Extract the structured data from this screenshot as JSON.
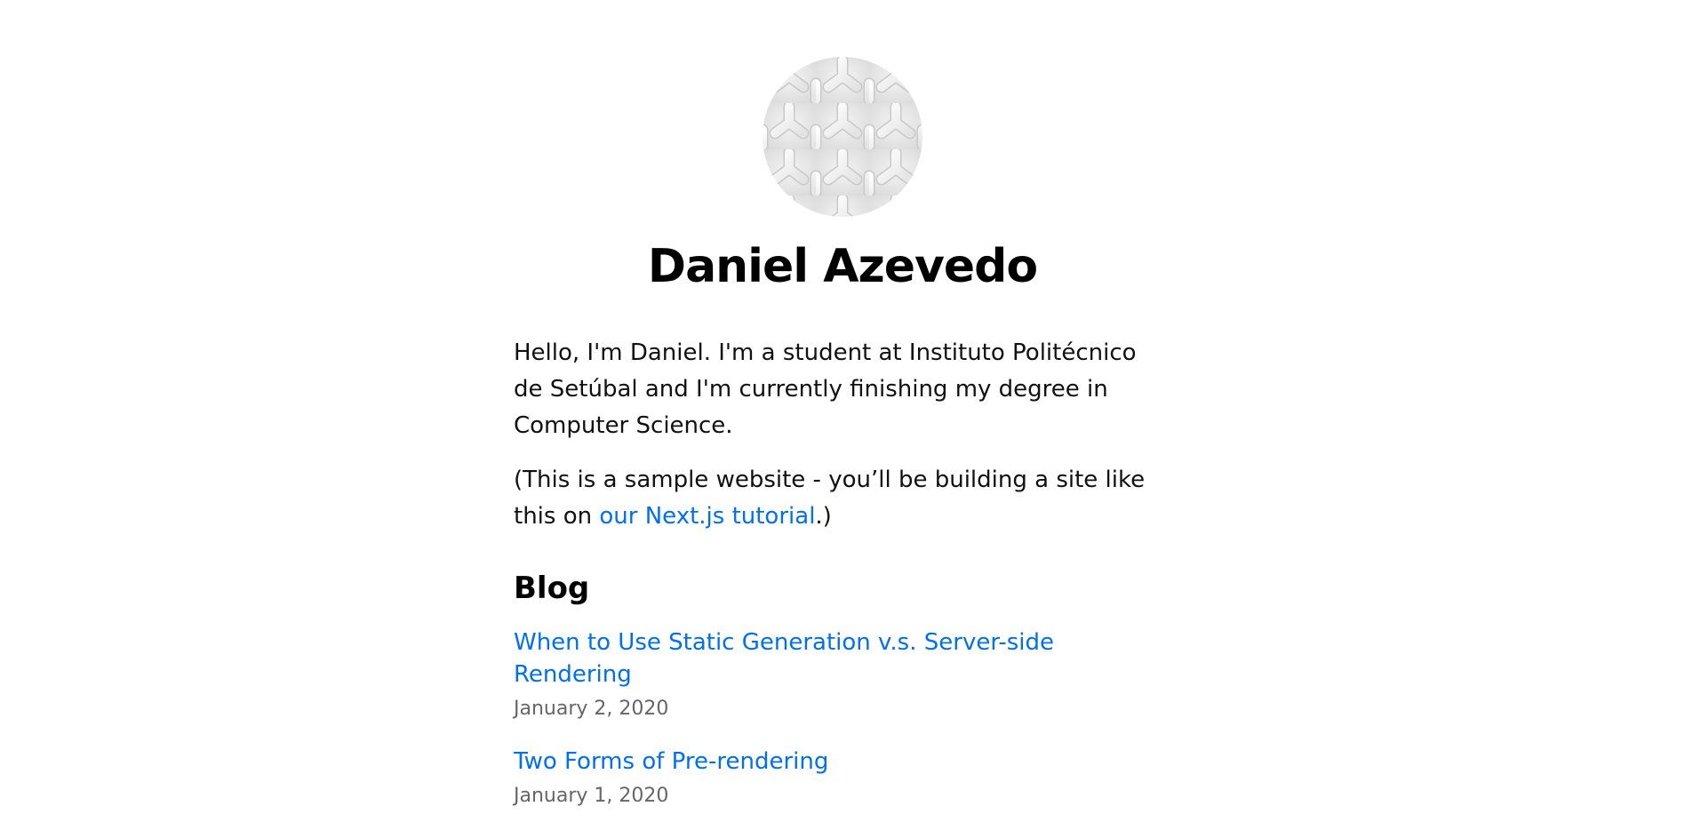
{
  "profile": {
    "name": "Daniel Azevedo",
    "avatar_icon": "woven-pattern-avatar"
  },
  "intro": {
    "bio": "Hello, I'm Daniel. I'm a student at Instituto Politécnico de Setúbal and I'm currently finishing my degree in Computer Science.",
    "sample_prefix": "(This is a sample website - you’ll be building a site like this on ",
    "tutorial_link": "our Next.js tutorial",
    "sample_suffix": ".)"
  },
  "blog": {
    "heading": "Blog",
    "posts": [
      {
        "title": "When to Use Static Generation v.s. Server-side Rendering",
        "date": "January 2, 2020"
      },
      {
        "title": "Two Forms of Pre-rendering",
        "date": "January 1, 2020"
      }
    ]
  },
  "colors": {
    "link": "#0070f3",
    "date": "#666666",
    "text": "#111111"
  }
}
